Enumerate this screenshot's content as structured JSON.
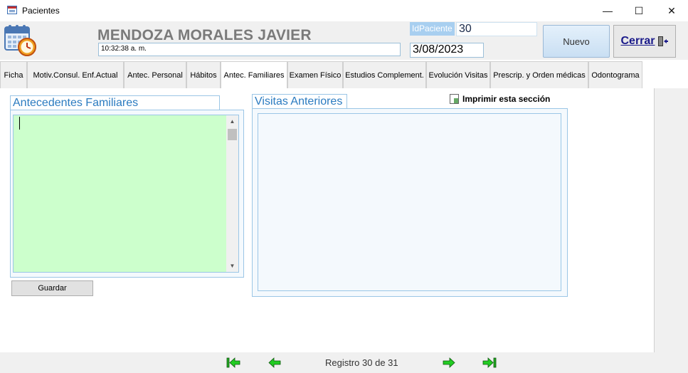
{
  "window": {
    "title": "Pacientes",
    "minimize_glyph": "—",
    "maximize_glyph": "☐",
    "close_glyph": "✕"
  },
  "header": {
    "patient_name": "MENDOZA MORALES JAVIER",
    "time": "10:32:38 a. m.",
    "id_label": "IdPaciente",
    "id_value": "30",
    "date": "3/08/2023",
    "new_button": "Nuevo",
    "close_button": "Cerrar"
  },
  "tabs": [
    {
      "label": "Ficha"
    },
    {
      "label": "Motiv.Consul. Enf.Actual"
    },
    {
      "label": "Antec. Personal"
    },
    {
      "label": "Hábitos"
    },
    {
      "label": "Antec. Familiares"
    },
    {
      "label": "Examen Físico"
    },
    {
      "label": "Estudios Complement."
    },
    {
      "label": "Evolución Visitas"
    },
    {
      "label": "Prescrip. y Orden médicas"
    },
    {
      "label": "Odontograma"
    }
  ],
  "family_history": {
    "title": "Antecedentes Familiares",
    "text": "",
    "save_button": "Guardar"
  },
  "previous_visits": {
    "title": "Visitas Anteriores",
    "print_link": "Imprimir esta sección"
  },
  "navigation": {
    "record_label": "Registro 30 de 31"
  },
  "colors": {
    "accent_blue": "#2b7bc0",
    "textarea_green": "#ccffcc",
    "nav_green": "#22aa22"
  }
}
